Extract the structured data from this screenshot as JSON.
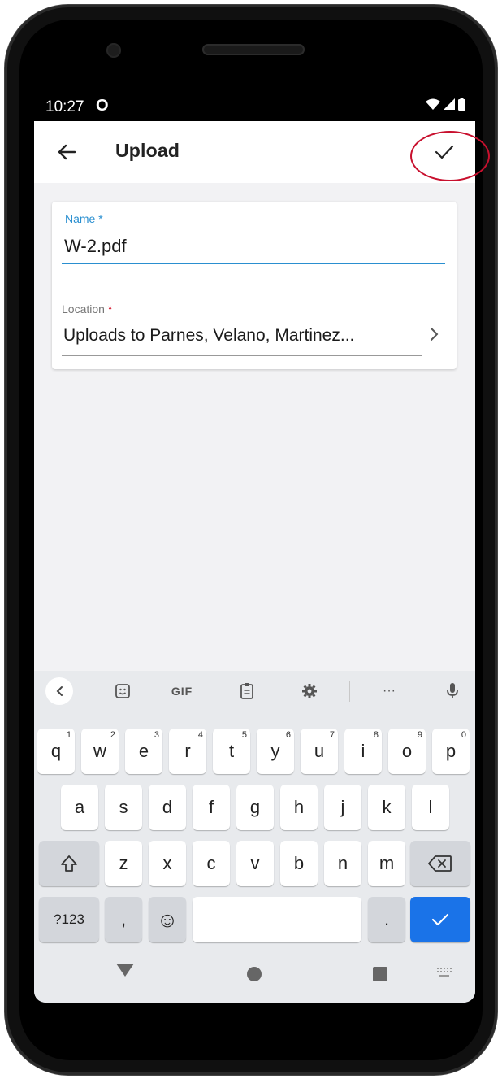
{
  "status_bar": {
    "time": "10:27",
    "notification_glyph": "O"
  },
  "app_bar": {
    "title": "Upload"
  },
  "form": {
    "name_label": "Name *",
    "name_value": "W-2.pdf",
    "location_label": "Location",
    "location_required_mark": "*",
    "location_value": "Uploads to Parnes, Velano, Martinez..."
  },
  "keyboard": {
    "toolbar": {
      "gif_label": "GIF",
      "more_label": "···"
    },
    "row1": [
      {
        "label": "q",
        "num": "1"
      },
      {
        "label": "w",
        "num": "2"
      },
      {
        "label": "e",
        "num": "3"
      },
      {
        "label": "r",
        "num": "4"
      },
      {
        "label": "t",
        "num": "5"
      },
      {
        "label": "y",
        "num": "6"
      },
      {
        "label": "u",
        "num": "7"
      },
      {
        "label": "i",
        "num": "8"
      },
      {
        "label": "o",
        "num": "9"
      },
      {
        "label": "p",
        "num": "0"
      }
    ],
    "row2": [
      "a",
      "s",
      "d",
      "f",
      "g",
      "h",
      "j",
      "k",
      "l"
    ],
    "row3": [
      "z",
      "x",
      "c",
      "v",
      "b",
      "n",
      "m"
    ],
    "symbols_label": "?123",
    "comma_label": ",",
    "period_label": ".",
    "emoji_glyph": "☺"
  },
  "colors": {
    "accent": "#2a8fd0",
    "required": "#d0021b",
    "enter_key": "#1a73e8",
    "annotation": "#c8102e"
  }
}
